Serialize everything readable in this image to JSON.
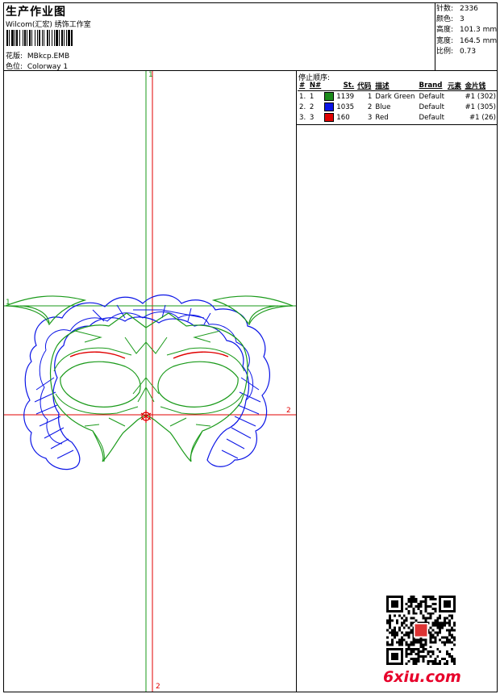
{
  "header": {
    "title": "生产作业图",
    "subtitle": "Wilcom(汇宏) 绣饰工作室",
    "design_label": "花版:",
    "design_file": "MBkcp.EMB",
    "colorway_label": "色位:",
    "colorway": "Colorway 1"
  },
  "stats": [
    {
      "label": "针数:",
      "value": "2336"
    },
    {
      "label": "颜色:",
      "value": "3"
    },
    {
      "label": "高度:",
      "value": "101.3 mm"
    },
    {
      "label": "宽度:",
      "value": "164.5 mm"
    },
    {
      "label": "比例:",
      "value": "0.73"
    }
  ],
  "stop_table": {
    "title": "停止顺序:",
    "headers": {
      "num": "#",
      "n": "N#",
      "st": "St.",
      "code": "代码",
      "desc": "描述",
      "brand": "Brand",
      "element": "元素",
      "sequin": "金片钱"
    },
    "rows": [
      {
        "num": "1.",
        "n": "1",
        "color": "#1a8a1a",
        "st": "1139",
        "code": "1",
        "desc": "Dark Green",
        "brand": "Default",
        "sequin": "#1 (302)"
      },
      {
        "num": "2.",
        "n": "2",
        "color": "#0a14e6",
        "st": "1035",
        "code": "2",
        "desc": "Blue",
        "brand": "Default",
        "sequin": "#1 (305)"
      },
      {
        "num": "3.",
        "n": "3",
        "color": "#e00000",
        "st": "160",
        "code": "3",
        "desc": "Red",
        "brand": "Default",
        "sequin": "#1 (26)"
      }
    ]
  },
  "design_area": {
    "axis_labels": {
      "green_v_top": "1",
      "green_h_left": "1",
      "red_h_right": "2",
      "red_v_bottom": "2"
    },
    "colors": {
      "green": "#1a9a1a",
      "blue": "#0a14e6",
      "red": "#e00000"
    }
  },
  "footer": {
    "brand": "6xiu.com"
  }
}
